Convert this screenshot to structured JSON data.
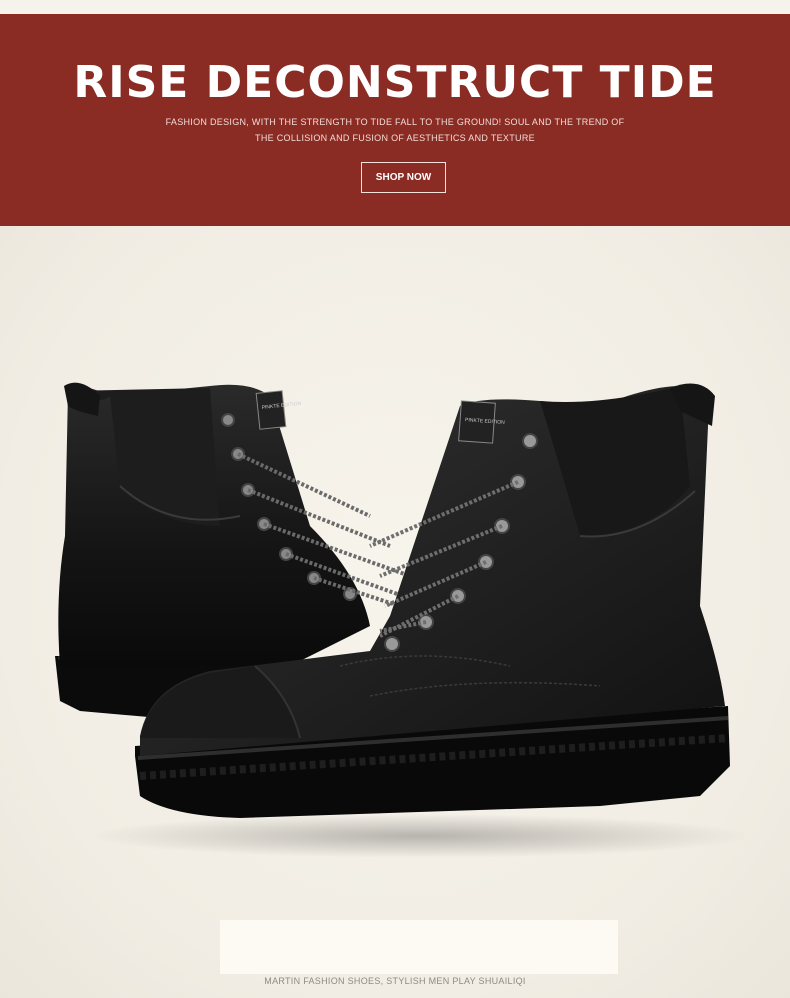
{
  "banner": {
    "title": "RISE DECONSTRUCT TIDE",
    "subtitle_line1": "FASHION DESIGN, WITH THE STRENGTH TO TIDE FALL TO THE GROUND! SOUL AND THE TREND OF",
    "subtitle_line2": "THE COLLISION AND FUSION OF AESTHETICS AND TEXTURE",
    "button_label": "SHOP NOW",
    "background_color": "#8a2c24"
  },
  "product": {
    "image_icon": "black-leather-martin-boots",
    "caption": "MARTIN FASHION SHOES, STYLISH MEN PLAY SHUAILIQI",
    "label_left": "PINKTE EDITION",
    "label_right": "PINKTE EDITION"
  }
}
